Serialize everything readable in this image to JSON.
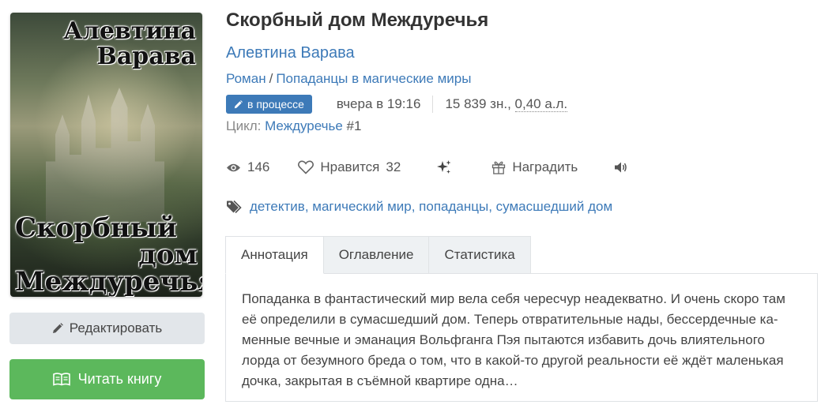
{
  "cover": {
    "author_line1": "Алевтина",
    "author_line2": "Варава",
    "title_line1": "Скорбный",
    "title_line2": "дом",
    "title_line3": "Междуречья"
  },
  "buttons": {
    "edit_label": "Редактировать",
    "edit_icon": "pencil-icon",
    "read_label": "Читать книгу",
    "read_icon": "open-book-icon"
  },
  "book": {
    "title": "Скорбный дом Междуречья",
    "author": "Алевтина Варава",
    "genre1": "Роман",
    "genre_sep": "/",
    "genre2": "Попаданцы в магические миры",
    "status_badge": "в процессе",
    "updated": "вчера в 19:16",
    "size_chars": "15 839 зн., ",
    "size_al": "0,40 а.л.",
    "cycle_label": "Цикл:",
    "cycle_name": "Междуречье",
    "cycle_num": "#1"
  },
  "stats": {
    "views": "146",
    "likes_label": "Нравится",
    "likes_count": "32",
    "award_label": "Наградить"
  },
  "tags": {
    "items": [
      "детектив",
      "магический мир",
      "попаданцы",
      "сумасшедший дом"
    ]
  },
  "tabs": [
    {
      "label": "Аннотация",
      "active": true
    },
    {
      "label": "Оглавление",
      "active": false
    },
    {
      "label": "Статистика",
      "active": false
    }
  ],
  "annotation": {
    "line1": "Попаданка в фантастический мир вела себя чересчур неадекватно. И очень скоро там",
    "line2": "её определили в сумасшедший дом. Теперь отвратительные нады, бессердечные ка-",
    "line3": "менные вечные и эманация Вольфганга Пэя пытаются избавить дочь влиятельного",
    "line4": "лорда от безумного бреда о том, что в какой-то другой реальности её ждёт маленькая",
    "line5": "дочка, закрытая в съёмной квартире одна…"
  },
  "colors": {
    "link": "#3d7ab8",
    "badge": "#3d7ab8",
    "read_button": "#5cb85c",
    "edit_button": "#e2e6ea"
  }
}
